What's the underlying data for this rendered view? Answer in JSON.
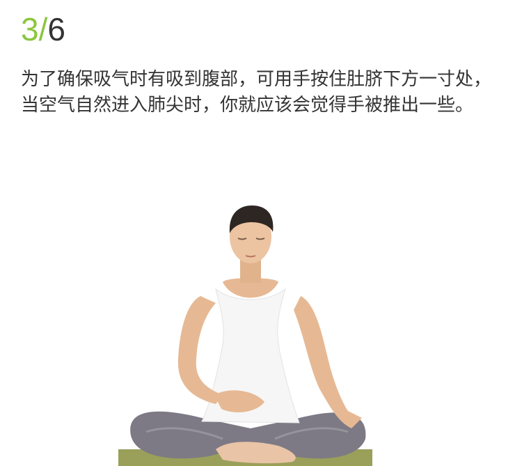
{
  "step": {
    "current": "3",
    "separator": "/",
    "total": "6"
  },
  "description": "为了确保吸气时有吸到腹部，可用手按住肚脐下方一寸处，当空气自然进入肺尖时，你就应该会觉得手被推出一些。",
  "colors": {
    "accent": "#8cc63f",
    "text": "#333333"
  },
  "illustration": "woman-seated-cross-legged-meditating-with-hand-on-abdomen"
}
